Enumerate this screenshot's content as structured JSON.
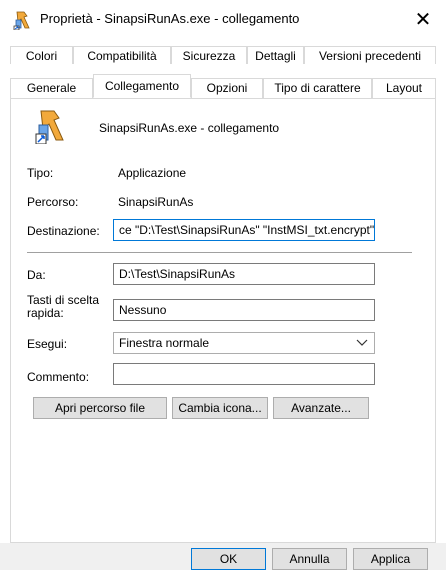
{
  "window": {
    "title": "Proprietà - SinapsiRunAs.exe - collegamento",
    "close_glyph": "✕"
  },
  "tabs_row1": [
    "Colori",
    "Compatibilità",
    "Sicurezza",
    "Dettagli",
    "Versioni precedenti"
  ],
  "tabs_row2": [
    "Generale",
    "Collegamento",
    "Opzioni",
    "Tipo di carattere",
    "Layout"
  ],
  "active_tab": "Collegamento",
  "shortcut_name": "SinapsiRunAs.exe - collegamento",
  "fields": {
    "tipo_label": "Tipo:",
    "tipo_value": "Applicazione",
    "percorso_label": "Percorso:",
    "percorso_value": "SinapsiRunAs",
    "destinazione_label": "Destinazione:",
    "destinazione_value": "ce \"D:\\Test\\SinapsiRunAs\" \"InstMSI_txt.encrypt\"",
    "da_label": "Da:",
    "da_value": "D:\\Test\\SinapsiRunAs",
    "tasti_label_1": "Tasti di scelta",
    "tasti_label_2": "rapida:",
    "tasti_value": "Nessuno",
    "esegui_label": "Esegui:",
    "esegui_value": "Finestra normale",
    "commento_label": "Commento:",
    "commento_value": ""
  },
  "buttons": {
    "apri": "Apri percorso file",
    "cambia": "Cambia icona...",
    "avanzate": "Avanzate...",
    "ok": "OK",
    "annulla": "Annulla",
    "applica": "Applica"
  },
  "icons": {
    "title": "shortcut-app-icon",
    "large": "shortcut-app-icon"
  }
}
